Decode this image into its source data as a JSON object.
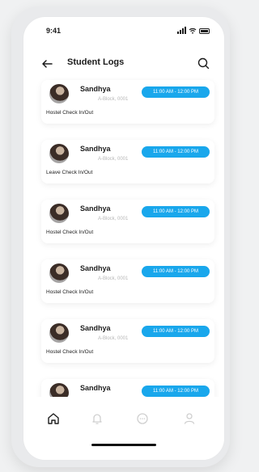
{
  "status_bar": {
    "time": "9:41",
    "icons": [
      "signal-icon",
      "wifi-icon",
      "battery-icon"
    ]
  },
  "header": {
    "title": "Student Logs",
    "back_icon": "arrow-left-icon",
    "search_icon": "search-icon"
  },
  "logs": [
    {
      "name": "Sandhya",
      "location": "A-Block, 0001",
      "time": "11:00 AM - 12:00 PM",
      "type": "Hostel Check In/Out"
    },
    {
      "name": "Sandhya",
      "location": "A-Block, 0001",
      "time": "11:00 AM - 12:00 PM",
      "type": "Leave Check In/Out"
    },
    {
      "name": "Sandhya",
      "location": "A-Block, 0001",
      "time": "11:00 AM - 12:00 PM",
      "type": "Hostel Check In/Out"
    },
    {
      "name": "Sandhya",
      "location": "A-Block, 0001",
      "time": "11:00 AM - 12:00 PM",
      "type": "Hostel Check In/Out"
    },
    {
      "name": "Sandhya",
      "location": "A-Block, 0001",
      "time": "11:00 AM - 12:00 PM",
      "type": "Hostel Check In/Out"
    },
    {
      "name": "Sandhya",
      "location": "",
      "time": "11:00 AM - 12:00 PM",
      "type": ""
    }
  ],
  "bottom_nav": {
    "items": [
      {
        "icon": "home-icon",
        "active": true
      },
      {
        "icon": "bell-icon",
        "active": false
      },
      {
        "icon": "chat-icon",
        "active": false
      },
      {
        "icon": "user-icon",
        "active": false
      }
    ]
  },
  "colors": {
    "accent": "#19a7ec",
    "background": "#f0f1f2",
    "card": "#ffffff",
    "text": "#1d1d1d",
    "muted": "#b8b8b8",
    "nav_active": "#1d1d1d",
    "nav_inactive": "#cfcfcf"
  }
}
